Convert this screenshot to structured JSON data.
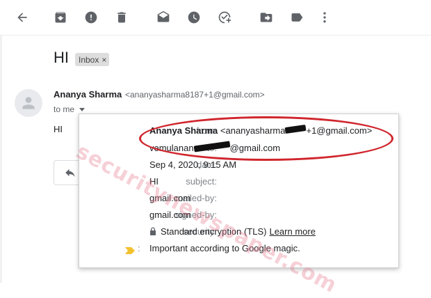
{
  "toolbar": {
    "icons": [
      "back-arrow-icon",
      "archive-icon",
      "report-spam-icon",
      "delete-icon",
      "mark-unread-icon",
      "snooze-icon",
      "add-to-tasks-icon",
      "move-to-icon",
      "labels-icon",
      "more-icon"
    ]
  },
  "email": {
    "subject": "HI",
    "label_chip": "Inbox",
    "label_chip_close": "×",
    "sender_name": "Ananya Sharma",
    "sender_email": "<ananyasharma8187+1@gmail.com>",
    "to_line": "to me",
    "body": "HI"
  },
  "details": {
    "from_label": "from:",
    "from_name": "Ananya Sharma",
    "from_email_prefix": "<ananyasharma",
    "from_email_suffix": "+1@gmail.com>",
    "to_label": "to:",
    "to_prefix": "vemulanan",
    "to_suffix": "@gmail.com",
    "date_label": "date:",
    "date_value": "Sep 4, 2020, 9:15 AM",
    "subject_label": "subject:",
    "subject_value": "HI",
    "mailed_by_label": "mailed-by:",
    "mailed_by_value": "gmail.com",
    "signed_by_label": "signed-by:",
    "signed_by_value": "gmail.com",
    "security_label": "security:",
    "security_value": "Standard encryption (TLS)",
    "security_link": "Learn more",
    "importance_value": "Important according to Google magic.",
    "importance_colon": ":"
  },
  "watermark": "securitynewspaper.com",
  "colors": {
    "annotation": "#d0262d",
    "importance_marker": "#f2c12e"
  }
}
